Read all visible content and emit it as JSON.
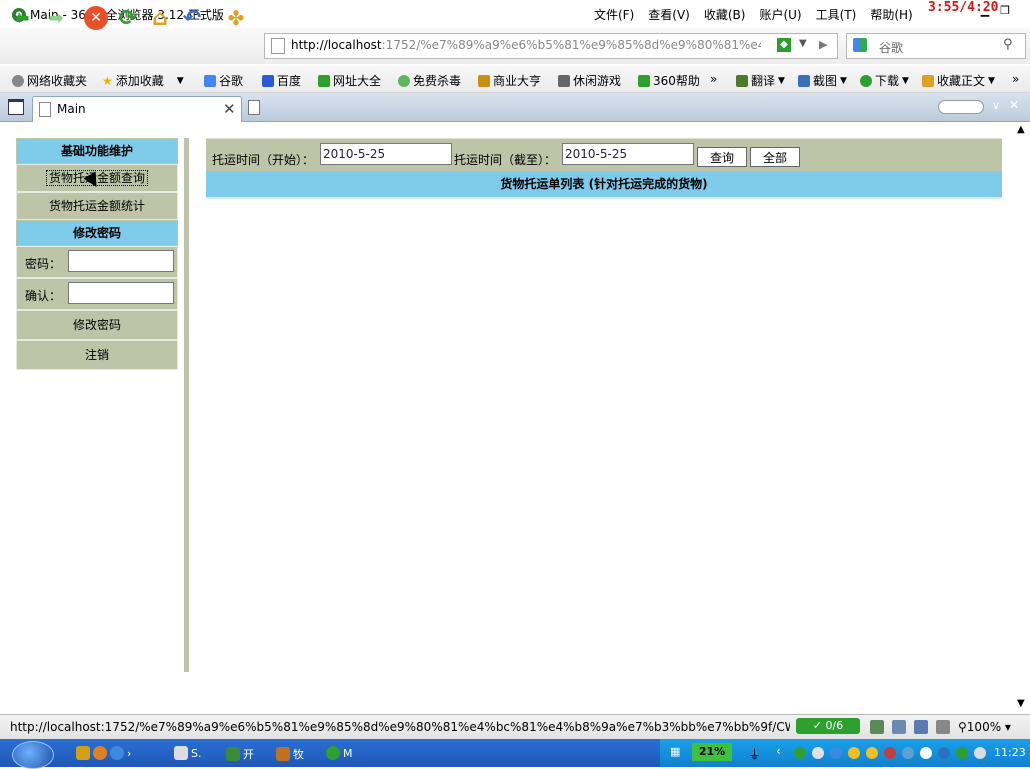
{
  "window": {
    "title": "Main - 360安全浏览器 3.12 正式版",
    "clock": "3:55/4:20",
    "menu": [
      "文件(F)",
      "查看(V)",
      "收藏(B)",
      "账户(U)",
      "工具(T)",
      "帮助(H)"
    ]
  },
  "address": {
    "host": "http://localhost",
    "rest": ":1752/%e7%89%a9%e6%b5%81%e9%85%8d%e9%80%81%e4%b"
  },
  "search": {
    "placeholder": "谷歌"
  },
  "favorites": [
    "网络收藏夹",
    "添加收藏",
    "谷歌",
    "百度",
    "网址大全",
    "免费杀毒",
    "商业大亨",
    "休闲游戏",
    "360帮助",
    "翻译",
    "截图",
    "下载",
    "收藏正文"
  ],
  "tab": {
    "label": "Main"
  },
  "left_panel": {
    "section1": "基础功能维护",
    "link1": "货物托运金额查询",
    "link2": "货物托运金额统计",
    "section2": "修改密码",
    "password_label": "密码：",
    "confirm_label": "确认：",
    "change_password": "修改密码",
    "logout": "注销"
  },
  "query": {
    "start_label": "托运时间（开始）：",
    "start_value": "2010-5-25",
    "end_label": "托运时间（截至）：",
    "end_value": "2010-5-25",
    "search_button": "查询",
    "all_button": "全部",
    "list_title": "货物托运单列表 (针对托运完成的货物)"
  },
  "status": {
    "url": "http://localhost:1752/%e7%89%a9%e6%b5%81%e9%85%8d%e9%80%81%e4%bc%81%e4%b8%9a%e7%b3%bb%e7%bb%9f/CW...",
    "counter": "0/6",
    "zoom": "100%"
  },
  "taskbar": {
    "tasks": [
      "S.",
      "开",
      "牧",
      "M"
    ],
    "battery": "21%",
    "time": "11:23"
  },
  "colors": {
    "panel_header": "#7ecbea",
    "panel_row": "#bdc4a8"
  }
}
